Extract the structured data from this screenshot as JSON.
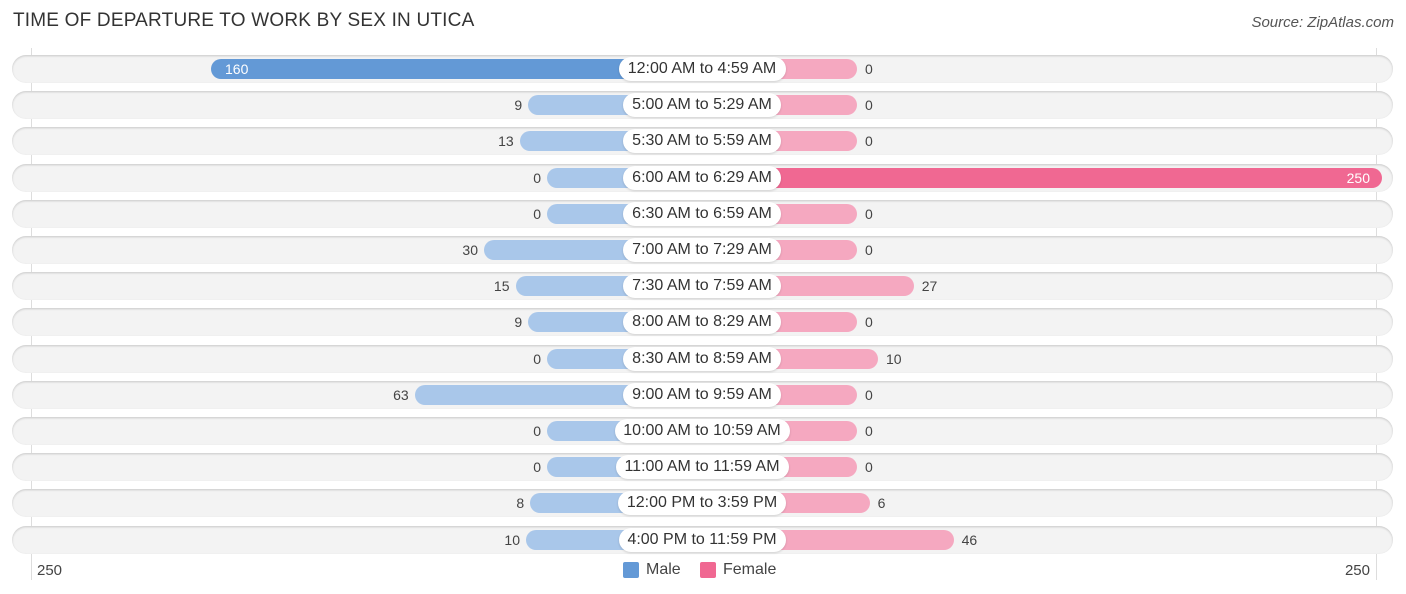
{
  "title": "TIME OF DEPARTURE TO WORK BY SEX IN UTICA",
  "source": "Source: ZipAtlas.com",
  "colors": {
    "male": "#6399d6",
    "male_light": "#a9c7ea",
    "female": "#f06892",
    "female_light": "#f5a8c0"
  },
  "legend": {
    "male": "Male",
    "female": "Female"
  },
  "axis": {
    "left_label": "250",
    "right_label": "250"
  },
  "chart_data": {
    "type": "bar",
    "orientation": "horizontal-diverging",
    "title": "TIME OF DEPARTURE TO WORK BY SEX IN UTICA",
    "categories": [
      "12:00 AM to 4:59 AM",
      "5:00 AM to 5:29 AM",
      "5:30 AM to 5:59 AM",
      "6:00 AM to 6:29 AM",
      "6:30 AM to 6:59 AM",
      "7:00 AM to 7:29 AM",
      "7:30 AM to 7:59 AM",
      "8:00 AM to 8:29 AM",
      "8:30 AM to 8:59 AM",
      "9:00 AM to 9:59 AM",
      "10:00 AM to 10:59 AM",
      "11:00 AM to 11:59 AM",
      "12:00 PM to 3:59 PM",
      "4:00 PM to 11:59 PM"
    ],
    "series": [
      {
        "name": "Male",
        "values": [
          160,
          9,
          13,
          0,
          0,
          30,
          15,
          9,
          0,
          63,
          0,
          0,
          8,
          10
        ]
      },
      {
        "name": "Female",
        "values": [
          0,
          0,
          0,
          250,
          0,
          0,
          27,
          0,
          10,
          0,
          0,
          0,
          6,
          46
        ]
      }
    ],
    "xlim": [
      -250,
      250
    ],
    "legend_position": "bottom-center"
  }
}
